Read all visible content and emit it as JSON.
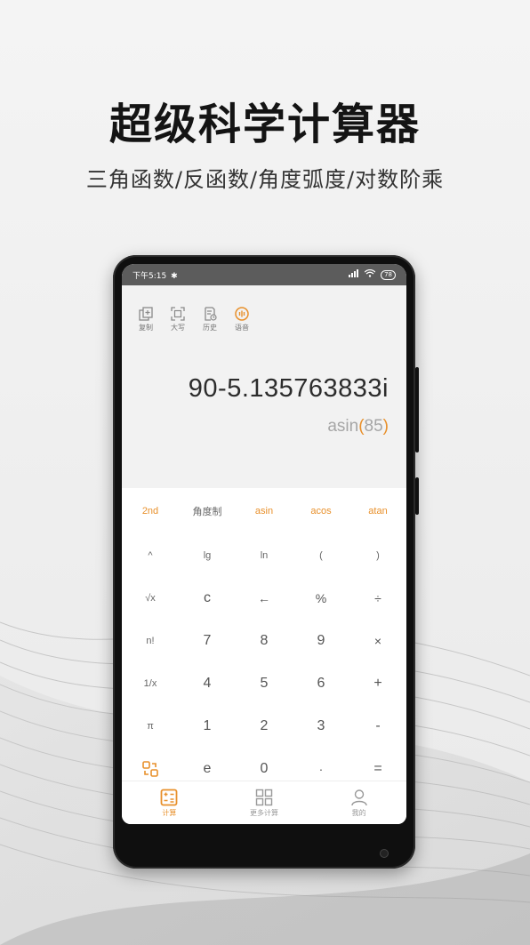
{
  "headline": "超级科学计算器",
  "subline": "三角函数/反函数/角度弧度/对数阶乘",
  "status": {
    "time": "下午5:15",
    "battery": "78"
  },
  "toolbar": [
    {
      "label": "复制",
      "icon": "copy-icon"
    },
    {
      "label": "大写",
      "icon": "scan-icon"
    },
    {
      "label": "历史",
      "icon": "history-icon"
    },
    {
      "label": "语音",
      "icon": "voice-icon"
    }
  ],
  "display": {
    "expression": "90-5.135763833i",
    "input_func": "asin",
    "input_open": "(",
    "input_num": "85",
    "input_close": ")"
  },
  "keys": {
    "row1": [
      "2nd",
      "角度制",
      "asin",
      "acos",
      "atan"
    ],
    "row2": [
      "^",
      "lg",
      "ln",
      "(",
      ")"
    ],
    "row3": [
      "√x",
      "c",
      "←",
      "%",
      "÷"
    ],
    "row4": [
      "n!",
      "7",
      "8",
      "9",
      "×"
    ],
    "row5": [
      "1/x",
      "4",
      "5",
      "6",
      "+"
    ],
    "row6": [
      "π",
      "1",
      "2",
      "3",
      "-"
    ],
    "row7": [
      "",
      "e",
      "0",
      "·",
      "="
    ]
  },
  "tabs": [
    {
      "label": "计算",
      "icon": "calculator-icon"
    },
    {
      "label": "更多计算",
      "icon": "grid-icon"
    },
    {
      "label": "我的",
      "icon": "user-icon"
    }
  ],
  "colors": {
    "accent": "#e8902b",
    "statusbar": "#5c5c5c",
    "display_bg": "#f2f2f2"
  }
}
